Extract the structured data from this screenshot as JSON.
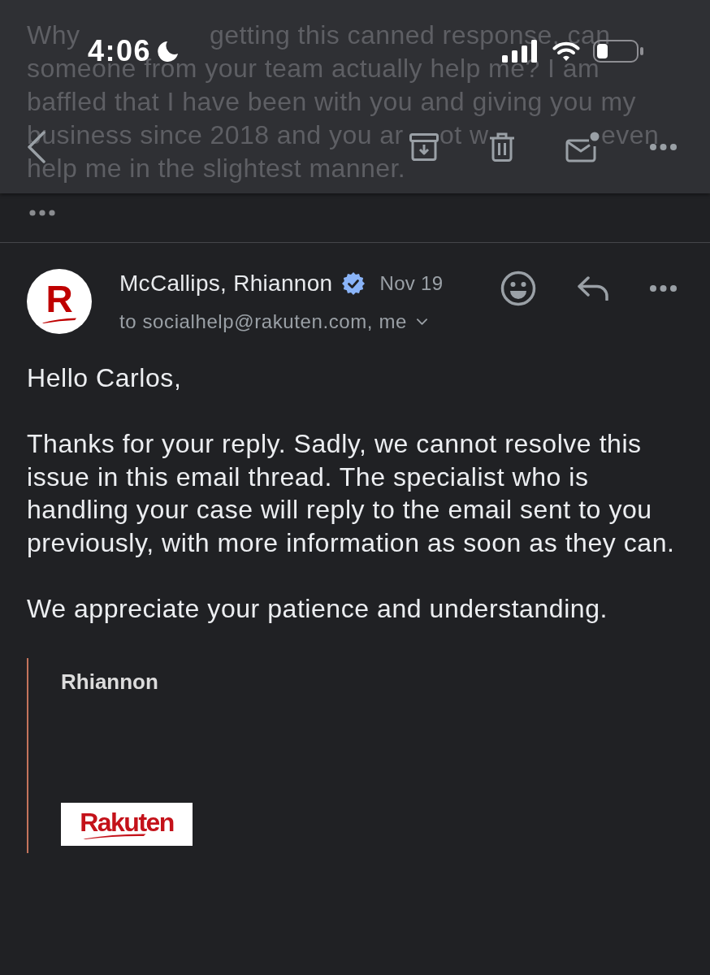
{
  "scrolled_message_lines": [
    [
      "Why",
      "getting this canned response, can"
    ],
    [
      "someone from your team actually help me? I am"
    ],
    [
      "baffled that I have been with you and giving you my"
    ],
    [
      "business since 2018 and you ar",
      "ot w",
      "even"
    ],
    [
      "help me in the slightest manner."
    ]
  ],
  "status_bar": {
    "time": "4:06"
  },
  "message": {
    "avatar_letter": "R",
    "sender": "McCallips, Rhiannon",
    "verified": true,
    "date": "Nov 19",
    "recipients": "to socialhelp@rakuten.com, me",
    "body": [
      "Hello Carlos,",
      "Thanks for your reply. Sadly, we cannot resolve this issue in this email thread. The specialist who is handling your case will reply to the email sent to you previously, with more information as soon as they can.",
      "We appreciate your patience and understanding."
    ],
    "signature": {
      "name": "Rhiannon",
      "logo_text": "Rakuten"
    }
  }
}
